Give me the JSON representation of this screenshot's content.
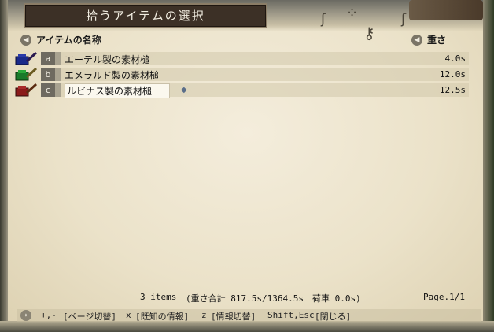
{
  "window": {
    "title": "拾うアイテムの選択"
  },
  "header": {
    "name_column": "アイテムの名称",
    "weight_column": "重さ"
  },
  "items": [
    {
      "letter": "a",
      "name": "エーテル製の素材槌",
      "weight": "4.0s",
      "color": "#1a2a8a"
    },
    {
      "letter": "b",
      "name": "エメラルド製の素材槌",
      "weight": "12.0s",
      "color": "#1a7a2a"
    },
    {
      "letter": "c",
      "name": "ルビナス製の素材槌",
      "weight": "12.5s",
      "color": "#8a1a1a",
      "selected": true
    }
  ],
  "summary": {
    "count": "3 items",
    "weight_total": "(重さ合計 817.5s/1364.5s　荷車 0.0s)",
    "page": "Page.1/1"
  },
  "help": {
    "page_key": "+,-",
    "page_label": "[ページ切替]",
    "known_key": "x",
    "known_label": "[既知の情報]",
    "info_key": "z",
    "info_label": "[情報切替]",
    "close_key": "Shift,Esc",
    "close_label": "[閉じる]"
  },
  "icons": {
    "item_icon": "hammer-icon",
    "header_icon": "speaker-icon",
    "help_icon": "lightbulb-icon",
    "gem": "gem-icon"
  }
}
